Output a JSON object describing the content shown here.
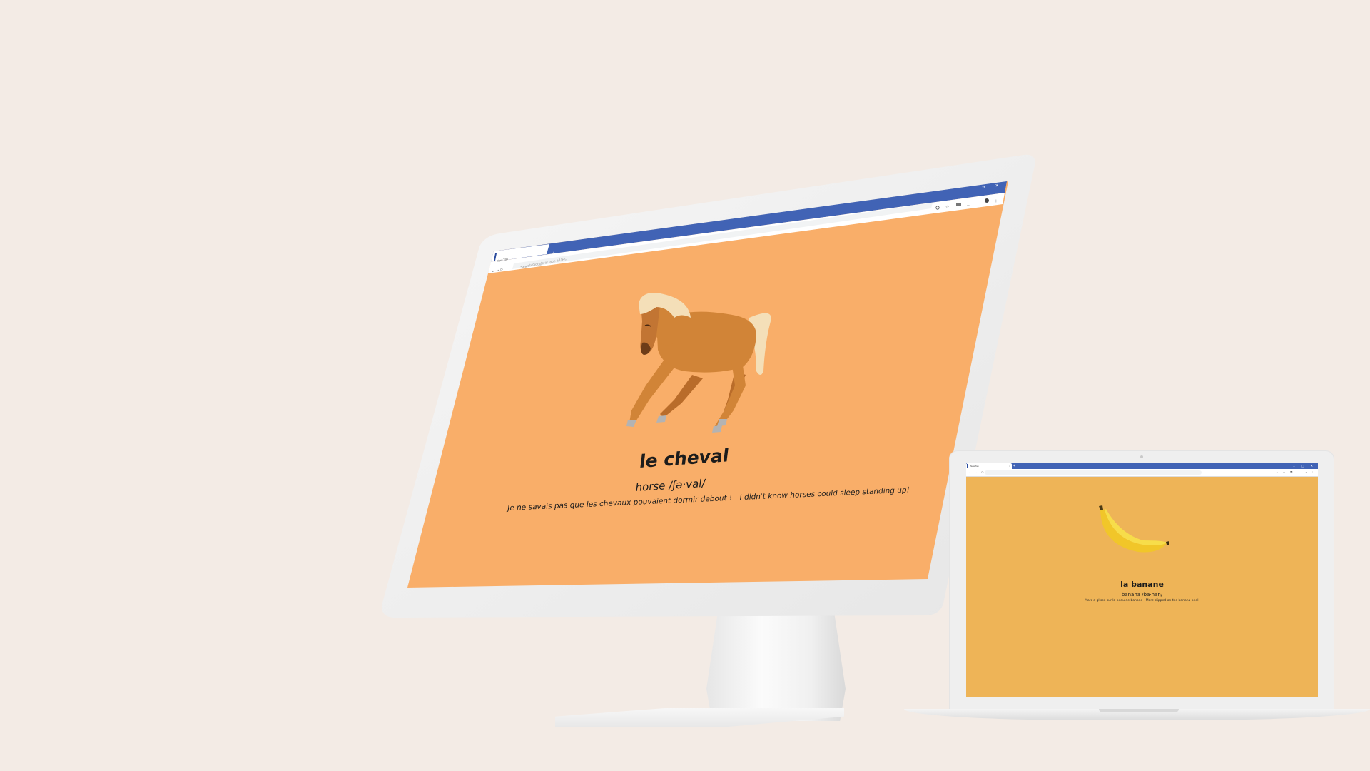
{
  "desktop_monitor": {
    "browser": {
      "tab_title": "New Tab",
      "tab_close": "×",
      "new_tab": "+",
      "omnibox_placeholder": "Search Google or type a URL",
      "window_restore": "⧉",
      "window_close": "✕",
      "toolbar_icons": [
        "zoom-icon",
        "star-icon",
        "extensions-icon",
        "ellipsis-icon",
        "profile-icon",
        "menu-icon"
      ]
    },
    "page": {
      "background_color": "#f9ae69",
      "image_subject": "horse-illustration",
      "word": "le cheval",
      "pronunciation": "horse /ʃə·val/",
      "example": "Je ne savais pas que les chevaux pouvaient dormir debout ! - I didn't know horses could sleep standing up!"
    }
  },
  "laptop": {
    "browser": {
      "tab_title": "New Tab",
      "tab_close": "×",
      "new_tab": "+",
      "window_controls": "– ▢ ✕",
      "nav_icons": "← → ⟳",
      "toolbar_icons": "⌕ ☆ ▦ ⋯ ● ⋮"
    },
    "page": {
      "background_color": "#eeb457",
      "image_subject": "banana-illustration",
      "word": "la banane",
      "pronunciation": "banana /ba·nan/",
      "example": "Marc a glissé sur la peau de banane - Marc slipped on the banana peel."
    }
  },
  "colors": {
    "background": "#f3ebe5",
    "browser_accent": "#4163b5",
    "device_shell": "#efefef"
  }
}
